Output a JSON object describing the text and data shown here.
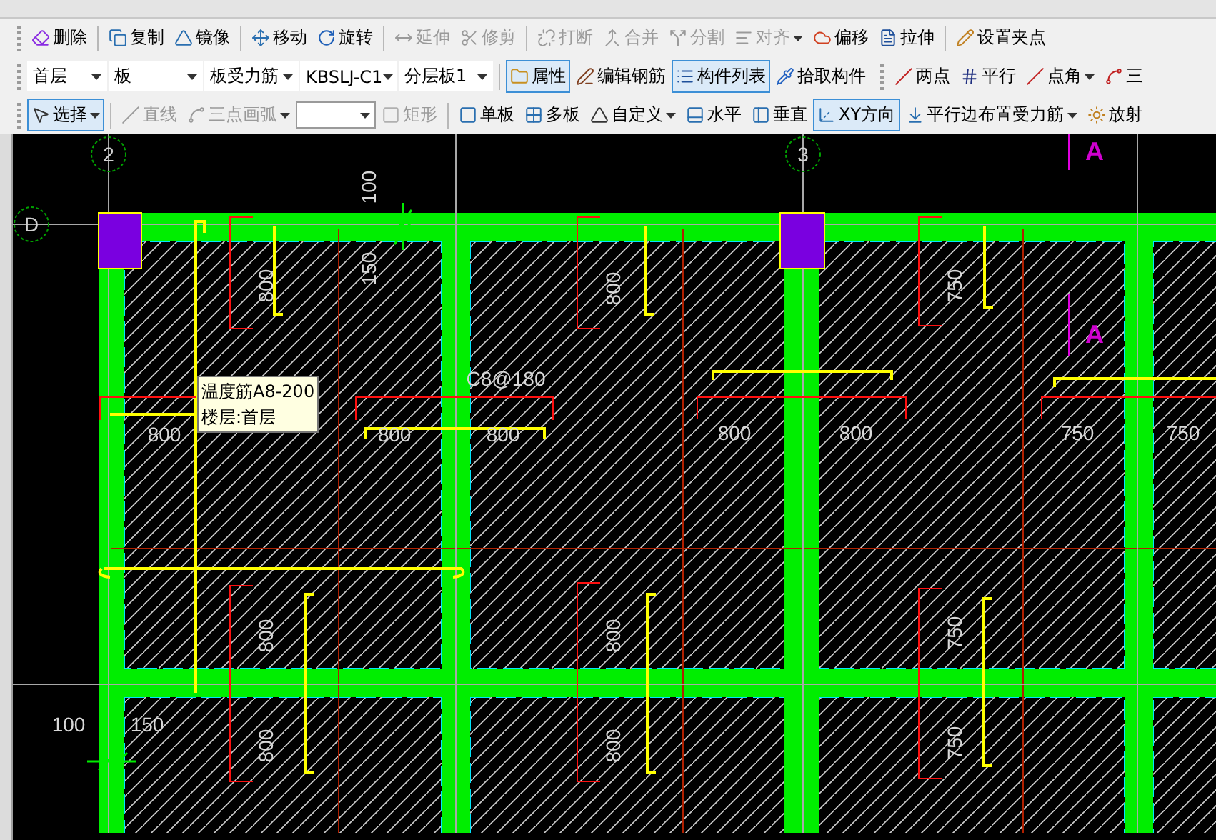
{
  "edit_toolbar": [
    {
      "label": "删除",
      "disabled": false,
      "dropdown": false
    },
    {
      "label": "复制",
      "disabled": false,
      "dropdown": false
    },
    {
      "label": "镜像",
      "disabled": false,
      "dropdown": false
    },
    {
      "label": "移动",
      "disabled": false,
      "dropdown": false
    },
    {
      "label": "旋转",
      "disabled": false,
      "dropdown": false
    },
    {
      "label": "延伸",
      "disabled": true,
      "dropdown": false
    },
    {
      "label": "修剪",
      "disabled": true,
      "dropdown": false
    },
    {
      "label": "打断",
      "disabled": true,
      "dropdown": false
    },
    {
      "label": "合并",
      "disabled": true,
      "dropdown": false
    },
    {
      "label": "分割",
      "disabled": true,
      "dropdown": false
    },
    {
      "label": "对齐",
      "disabled": true,
      "dropdown": true
    },
    {
      "label": "偏移",
      "disabled": false,
      "dropdown": false
    },
    {
      "label": "拉伸",
      "disabled": false,
      "dropdown": false
    },
    {
      "label": "设置夹点",
      "disabled": false,
      "dropdown": false
    }
  ],
  "layer_toolbar": {
    "selectors": [
      {
        "value": "首层"
      },
      {
        "value": "板"
      },
      {
        "value": "板受力筋"
      },
      {
        "value": "KBSLJ-C1"
      },
      {
        "value": "分层板1"
      }
    ],
    "buttons": [
      {
        "label": "属性",
        "selected": true
      },
      {
        "label": "编辑钢筋",
        "selected": false
      },
      {
        "label": "构件列表",
        "selected": true
      },
      {
        "label": "拾取构件",
        "selected": false
      }
    ],
    "snap_buttons": [
      {
        "label": "两点",
        "dropdown": false
      },
      {
        "label": "平行",
        "dropdown": false
      },
      {
        "label": "点角",
        "dropdown": true
      },
      {
        "label": "三",
        "dropdown": false
      }
    ]
  },
  "draw_toolbar": [
    {
      "kind": "button",
      "label": "选择",
      "selected": true,
      "disabled": false,
      "dropdown": true
    },
    {
      "kind": "button",
      "label": "直线",
      "selected": false,
      "disabled": true,
      "dropdown": false
    },
    {
      "kind": "button",
      "label": "三点画弧",
      "selected": false,
      "disabled": true,
      "dropdown": true
    },
    {
      "kind": "combo"
    },
    {
      "kind": "button",
      "label": "矩形",
      "selected": false,
      "disabled": true,
      "dropdown": false
    },
    {
      "kind": "button",
      "label": "单板",
      "selected": false,
      "disabled": false,
      "dropdown": false
    },
    {
      "kind": "button",
      "label": "多板",
      "selected": false,
      "disabled": false,
      "dropdown": false
    },
    {
      "kind": "button",
      "label": "自定义",
      "selected": false,
      "disabled": false,
      "dropdown": true
    },
    {
      "kind": "button",
      "label": "水平",
      "selected": false,
      "disabled": false,
      "dropdown": false
    },
    {
      "kind": "button",
      "label": "垂直",
      "selected": false,
      "disabled": false,
      "dropdown": false
    },
    {
      "kind": "button",
      "label": "XY方向",
      "selected": true,
      "disabled": false,
      "dropdown": false
    },
    {
      "kind": "button",
      "label": "平行边布置受力筋",
      "selected": false,
      "disabled": false,
      "dropdown": true
    },
    {
      "kind": "button",
      "label": "放射",
      "selected": false,
      "disabled": false,
      "dropdown": false
    }
  ],
  "canvas": {
    "axis_bubbles": [
      "2",
      "3",
      "D"
    ],
    "markers": [
      "A",
      "A"
    ],
    "dimension_labels": [
      "100",
      "150",
      "800",
      "800",
      "750",
      "C8@180",
      "800",
      "800",
      "800",
      "800",
      "800",
      "750",
      "750",
      "800",
      "800",
      "750",
      "100",
      "150",
      "800",
      "800",
      "750"
    ],
    "tooltip": [
      "温度筋A8-200",
      "楼层:首层"
    ]
  }
}
